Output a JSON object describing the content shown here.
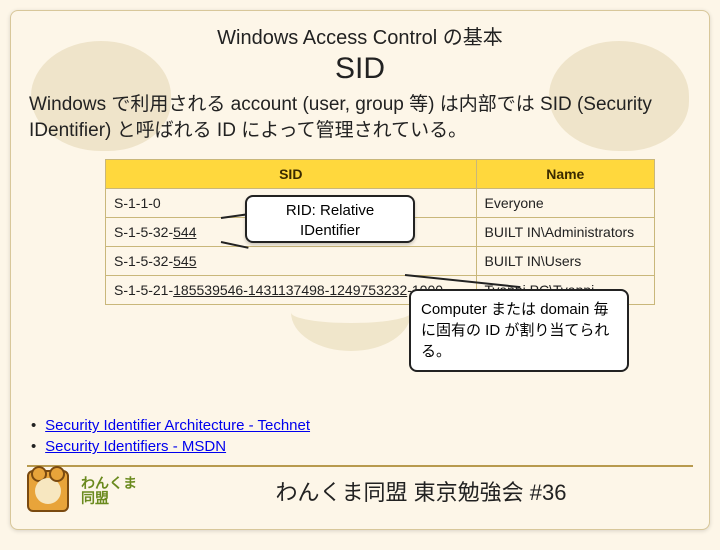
{
  "pre_title": "Windows Access Control の基本",
  "main_title": "SID",
  "description": "Windows で利用される account (user,  group 等) は内部では SID (Security IDentifier) と呼ばれる ID によって管理されている。",
  "table": {
    "headers": {
      "sid": "SID",
      "name": "Name"
    },
    "rows": [
      {
        "sid_plain": "S-1-1-0",
        "sid_uline": "",
        "name": "Everyone"
      },
      {
        "sid_plain": "S-1-5-32-",
        "sid_uline": "544",
        "name": "BUILT IN\\Administrators"
      },
      {
        "sid_plain": "S-1-5-32-",
        "sid_uline": "545",
        "name": "BUILT IN\\Users"
      },
      {
        "sid_plain": "S-1-5-21-",
        "sid_uline": "185539546-1431137498-1249753232",
        "sid_tail": "-1000",
        "name": "Tyappi.PC\\Tyappi"
      }
    ]
  },
  "rid_callout": {
    "line1": "RID: Relative",
    "line2": "IDentifier"
  },
  "note": "Computer または domain 毎に固有の ID が割り当てられる。",
  "links": [
    {
      "label": "Security Identifier Architecture - Technet"
    },
    {
      "label": "Security Identifiers - MSDN"
    }
  ],
  "footer": {
    "brand_line1": "わんくま",
    "brand_line2": "同盟",
    "title": "わんくま同盟 東京勉強会 #36"
  }
}
